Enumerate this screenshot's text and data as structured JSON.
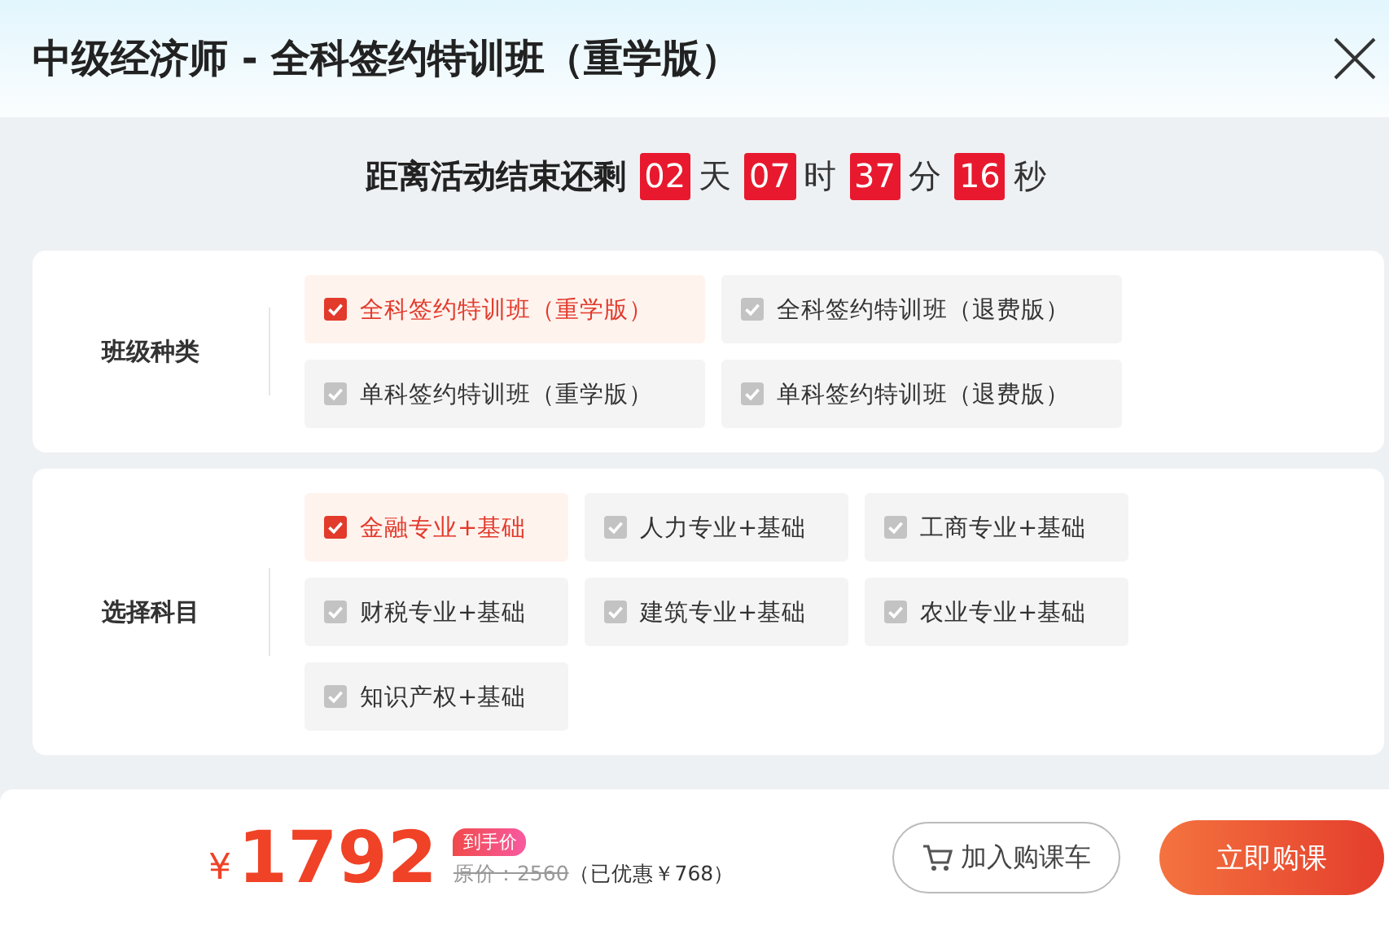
{
  "title": "中级经济师 - 全科签约特训班（重学版）",
  "countdown": {
    "label": "距离活动结束还剩",
    "parts": [
      {
        "value": "02",
        "unit": "天"
      },
      {
        "value": "07",
        "unit": "时"
      },
      {
        "value": "37",
        "unit": "分"
      },
      {
        "value": "16",
        "unit": "秒"
      }
    ]
  },
  "sections": [
    {
      "label": "班级种类",
      "kind": "wide",
      "options": [
        {
          "label": "全科签约特训班（重学版）",
          "selected": true
        },
        {
          "label": "全科签约特训班（退费版）",
          "selected": false
        },
        {
          "label": "单科签约特训班（重学版）",
          "selected": false
        },
        {
          "label": "单科签约特训班（退费版）",
          "selected": false
        }
      ]
    },
    {
      "label": "选择科目",
      "kind": "narrow",
      "options": [
        {
          "label": "金融专业+基础",
          "selected": true
        },
        {
          "label": "人力专业+基础",
          "selected": false
        },
        {
          "label": "工商专业+基础",
          "selected": false
        },
        {
          "label": "财税专业+基础",
          "selected": false
        },
        {
          "label": "建筑专业+基础",
          "selected": false
        },
        {
          "label": "农业专业+基础",
          "selected": false
        },
        {
          "label": "知识产权+基础",
          "selected": false
        }
      ]
    }
  ],
  "footer": {
    "currency": "¥",
    "price": "1792",
    "badge": "到手价",
    "original_price": "原价：2560",
    "discount": "（已优惠￥768）",
    "cart_button": "加入购课车",
    "buy_button": "立即购课"
  }
}
